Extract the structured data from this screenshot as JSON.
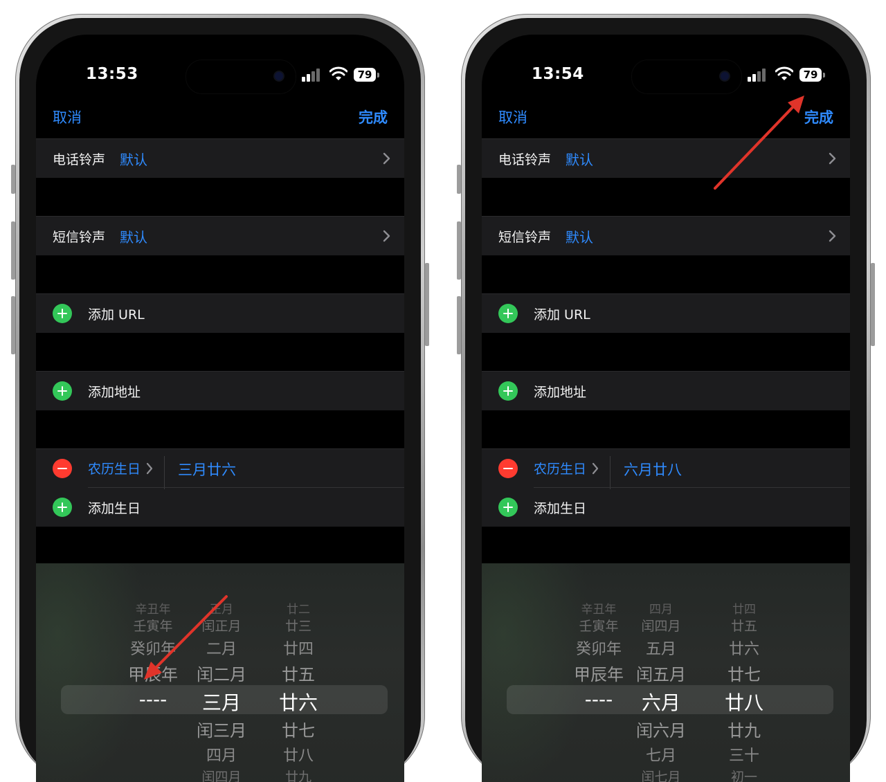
{
  "colors": {
    "accent": "#2f8bff",
    "add": "#33c759",
    "remove": "#ff3b30",
    "annotation_arrow": "#e0342a"
  },
  "screens": [
    {
      "status": {
        "time": "13:53",
        "battery": "79"
      },
      "nav": {
        "cancel": "取消",
        "done": "完成"
      },
      "ringtone": {
        "label": "电话铃声",
        "value": "默认"
      },
      "texttone": {
        "label": "短信铃声",
        "value": "默认"
      },
      "add_url": {
        "label": "添加 URL"
      },
      "add_address": {
        "label": "添加地址"
      },
      "birthday": {
        "type": "农历生日",
        "date": "三月廿六"
      },
      "add_birthday": {
        "label": "添加生日"
      },
      "picker": {
        "year": [
          "辛丑年",
          "壬寅年",
          "癸卯年",
          "甲辰年",
          "----"
        ],
        "month": [
          "正月",
          "闰正月",
          "二月",
          "闰二月",
          "三月",
          "闰三月",
          "四月",
          "闰四月"
        ],
        "day": [
          "廿二",
          "廿三",
          "廿四",
          "廿五",
          "廿六",
          "廿七",
          "廿八",
          "廿九"
        ]
      }
    },
    {
      "status": {
        "time": "13:54",
        "battery": "79"
      },
      "nav": {
        "cancel": "取消",
        "done": "完成"
      },
      "ringtone": {
        "label": "电话铃声",
        "value": "默认"
      },
      "texttone": {
        "label": "短信铃声",
        "value": "默认"
      },
      "add_url": {
        "label": "添加 URL"
      },
      "add_address": {
        "label": "添加地址"
      },
      "birthday": {
        "type": "农历生日",
        "date": "六月廿八"
      },
      "add_birthday": {
        "label": "添加生日"
      },
      "picker": {
        "year": [
          "辛丑年",
          "壬寅年",
          "癸卯年",
          "甲辰年",
          "----"
        ],
        "month": [
          "四月",
          "闰四月",
          "五月",
          "闰五月",
          "六月",
          "闰六月",
          "七月",
          "闰七月"
        ],
        "day": [
          "廿四",
          "廿五",
          "廿六",
          "廿七",
          "廿八",
          "廿九",
          "三十",
          "初一"
        ]
      }
    }
  ]
}
